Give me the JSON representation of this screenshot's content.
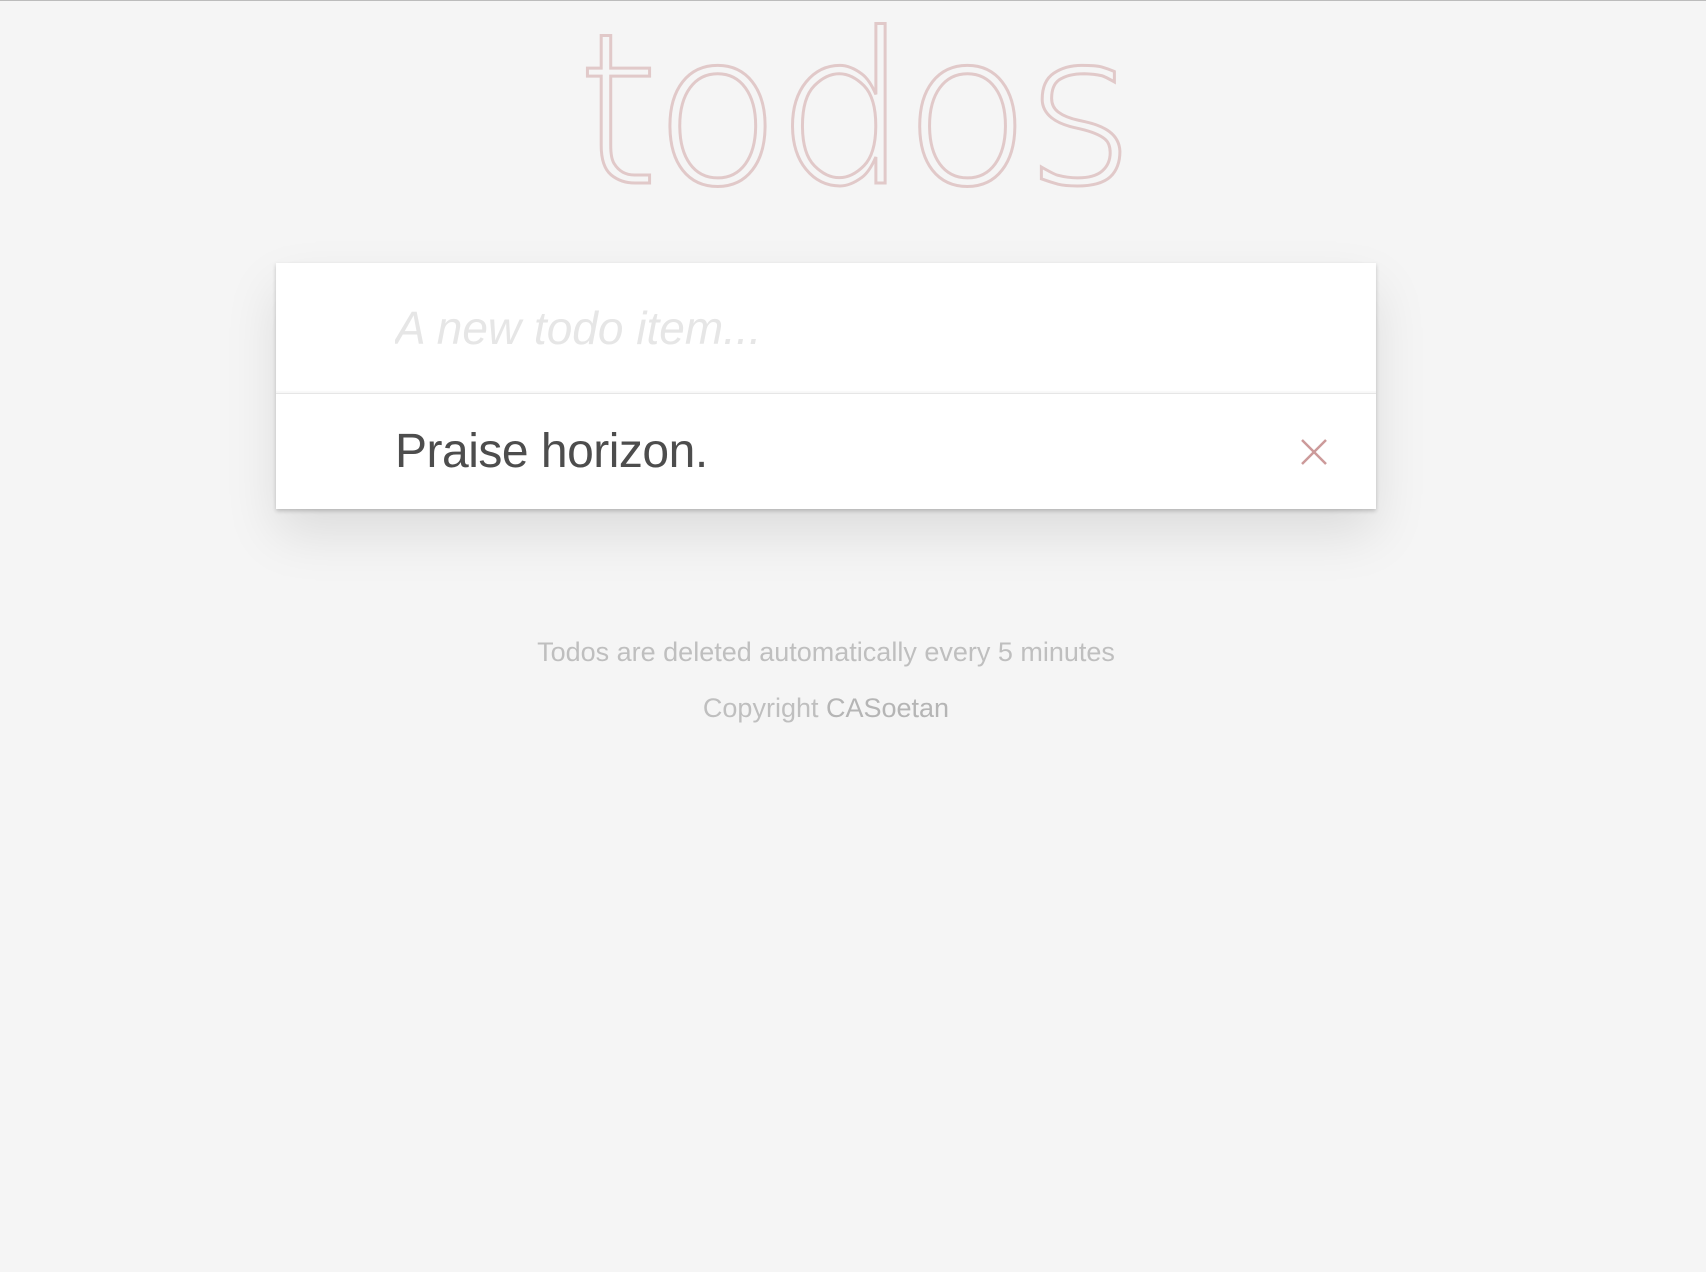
{
  "header": {
    "title": "todos"
  },
  "new_todo": {
    "placeholder": "A new todo item...",
    "value": ""
  },
  "todos": [
    {
      "label": "Praise horizon.",
      "icon": "close-icon"
    }
  ],
  "footer": {
    "note": "Todos are deleted automatically every 5 minutes",
    "copyright_prefix": "Copyright ",
    "author": "CASoetan"
  },
  "colors": {
    "background": "#f5f5f5",
    "title": "#ead7d7",
    "delete_icon": "#cc9a9a",
    "todo_text": "#4d4d4d",
    "footer_text": "#bfbfbf"
  }
}
